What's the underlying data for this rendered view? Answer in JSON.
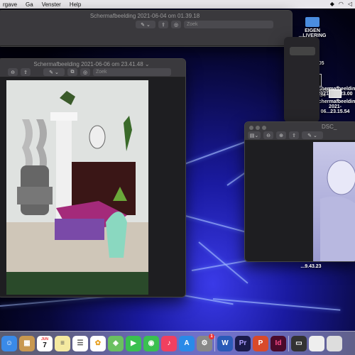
{
  "menubar": {
    "items": [
      "rgave",
      "Ga",
      "Venster",
      "Help"
    ]
  },
  "back_window": {
    "title": "Schermafbeelding 2021-06-04 om 01.39.18",
    "search_placeholder": "Zoek"
  },
  "main_window": {
    "title": "Schermafbeelding 2021-06-06 om 23.41.48",
    "title_chevron": "⌄",
    "search_placeholder": "Zoek"
  },
  "right_window": {
    "title": "DSC_"
  },
  "desktop_icons": [
    {
      "label": "EIGEN",
      "sublabel": "...LIVERING"
    },
    {
      "label": "...15.36.05"
    },
    {
      "label": "Schermafbeeldin",
      "sublabel": "2021-06...23.00"
    },
    {
      "label": "Schermafbeeldin",
      "sublabel": "...22.59.34"
    },
    {
      "label": "Schermafbeeldin",
      "sublabel": "2021-06...23.15.54"
    },
    {
      "label": "...9.43.23"
    }
  ],
  "dock": {
    "calendar_day": "7",
    "calendar_month": "JUN",
    "settings_badge": "1",
    "apps": [
      "finder-icon",
      "notes-icon",
      "calendar-icon",
      "reminders-icon",
      "textedit-icon",
      "photos-icon",
      "maps-icon",
      "facetime-icon",
      "messages-icon",
      "music-icon",
      "appstore-icon",
      "settings-icon",
      "word-icon",
      "premiere-icon",
      "powerpoint-icon",
      "indesign-icon"
    ]
  }
}
